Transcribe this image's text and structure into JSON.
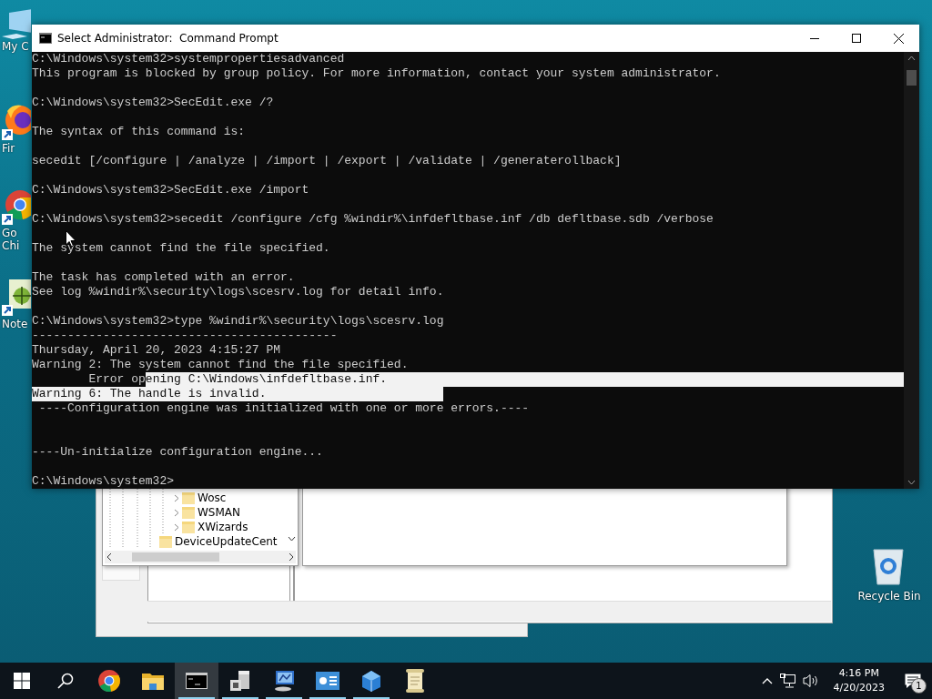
{
  "desktop_icons": [
    {
      "kind": "computer",
      "label_lines": [
        "My C"
      ]
    },
    {
      "kind": "fox",
      "label_lines": [
        "Fir"
      ]
    },
    {
      "kind": "browser",
      "label_lines": [
        "Go",
        "Chi"
      ]
    },
    {
      "kind": "notepad",
      "label_lines": [
        "Note"
      ]
    }
  ],
  "recycle_bin": {
    "label": "Recycle Bin"
  },
  "background_window": {
    "tree": [
      {
        "kind": "collapsed",
        "label": "Wosc"
      },
      {
        "kind": "collapsed",
        "label": "WSMAN"
      },
      {
        "kind": "collapsed",
        "label": "XWizards"
      },
      {
        "kind": "leaf",
        "label": "DeviceUpdateCent"
      }
    ]
  },
  "console": {
    "title": "Select Administrator:  Command Prompt",
    "lines": [
      {
        "kind": "text",
        "text": "C:\\Windows\\system32>systempropertiesadvanced"
      },
      {
        "kind": "text",
        "text": "This program is blocked by group policy. For more information, contact your system administrator."
      },
      {
        "kind": "blank"
      },
      {
        "kind": "text",
        "text": "C:\\Windows\\system32>SecEdit.exe /?"
      },
      {
        "kind": "blank"
      },
      {
        "kind": "text",
        "text": "The syntax of this command is:"
      },
      {
        "kind": "blank"
      },
      {
        "kind": "text",
        "text": "secedit [/configure | /analyze | /import | /export | /validate | /generaterollback]"
      },
      {
        "kind": "blank"
      },
      {
        "kind": "text",
        "text": "C:\\Windows\\system32>SecEdit.exe /import"
      },
      {
        "kind": "blank"
      },
      {
        "kind": "text",
        "text": "C:\\Windows\\system32>secedit /configure /cfg %windir%\\infdefltbase.inf /db defltbase.sdb /verbose"
      },
      {
        "kind": "blank"
      },
      {
        "kind": "text",
        "text": "The system cannot find the file specified."
      },
      {
        "kind": "blank"
      },
      {
        "kind": "text",
        "text": "The task has completed with an error."
      },
      {
        "kind": "text",
        "text": "See log %windir%\\security\\logs\\scesrv.log for detail info."
      },
      {
        "kind": "blank"
      },
      {
        "kind": "text",
        "text": "C:\\Windows\\system32>type %windir%\\security\\logs\\scesrv.log"
      },
      {
        "kind": "text",
        "text": "-------------------------------------------"
      },
      {
        "kind": "text",
        "text": "Thursday, April 20, 2023 4:15:27 PM"
      },
      {
        "kind": "text",
        "text": "Warning 2: The system cannot find the file specified."
      },
      {
        "kind": "selection",
        "selection_to_end": true,
        "segments": [
          {
            "text": "        Error op",
            "selected": false
          },
          {
            "text": "ening C:\\Windows\\infdefltbase.inf.",
            "selected": true
          }
        ]
      },
      {
        "kind": "selection",
        "selection_to_end": false,
        "segments": [
          {
            "text": "Warning 6: The handle is invalid.                         ",
            "selected": true
          }
        ]
      },
      {
        "kind": "text",
        "text": " ----Configuration engine was initialized with one or more errors.----"
      },
      {
        "kind": "blank"
      },
      {
        "kind": "blank"
      },
      {
        "kind": "text",
        "text": "----Un-initialize configuration engine..."
      },
      {
        "kind": "blank"
      },
      {
        "kind": "text",
        "text": "C:\\Windows\\system32>"
      }
    ]
  },
  "taskbar": {
    "apps": [
      {
        "kind": "browser",
        "open": false,
        "active": false
      },
      {
        "kind": "folder",
        "open": false,
        "active": false
      },
      {
        "kind": "terminal",
        "open": true,
        "active": true
      },
      {
        "kind": "server",
        "open": true,
        "active": false
      },
      {
        "kind": "monitor",
        "open": true,
        "active": false
      },
      {
        "kind": "card",
        "open": true,
        "active": false
      },
      {
        "kind": "cube",
        "open": true,
        "active": false
      },
      {
        "kind": "scroll",
        "open": false,
        "active": false
      }
    ],
    "clock": {
      "time": "4:16 PM",
      "date": "4/20/2023"
    },
    "notifications": {
      "count": "1"
    }
  }
}
